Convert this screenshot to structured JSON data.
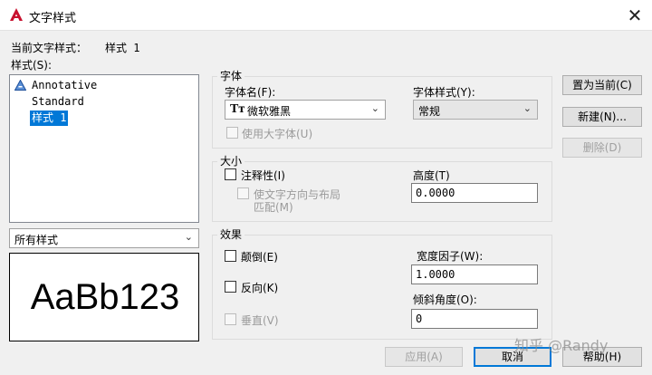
{
  "window": {
    "title": "文字样式",
    "close_glyph": "✕"
  },
  "current_style": {
    "label": "当前文字样式：",
    "value": "样式 1"
  },
  "styles": {
    "label": "样式(S):",
    "items": [
      {
        "label": "Annotative",
        "annotative": true,
        "selected": false
      },
      {
        "label": "Standard",
        "annotative": false,
        "selected": false
      },
      {
        "label": "样式 1",
        "annotative": false,
        "selected": true
      }
    ]
  },
  "filter": {
    "value": "所有样式"
  },
  "preview": {
    "text": "AaBb123"
  },
  "font": {
    "group_label": "字体",
    "name_label": "字体名(F):",
    "name_value": "微软雅黑",
    "style_label": "字体样式(Y):",
    "style_value": "常规",
    "bigfont_label": "使用大字体(U)"
  },
  "size": {
    "group_label": "大小",
    "annotative_label": "注释性(I)",
    "match_orientation_line1": "使文字方向与布局",
    "match_orientation_line2": "匹配(M)",
    "height_label": "高度(T)",
    "height_value": "0.0000"
  },
  "effects": {
    "group_label": "效果",
    "upside_down_label": "颠倒(E)",
    "backwards_label": "反向(K)",
    "vertical_label": "垂直(V)",
    "width_factor_label": "宽度因子(W):",
    "width_factor_value": "1.0000",
    "oblique_label": "倾斜角度(O):",
    "oblique_value": "0"
  },
  "buttons": {
    "set_current": "置为当前(C)",
    "new": "新建(N)...",
    "delete": "删除(D)",
    "apply": "应用(A)",
    "cancel": "取消",
    "help": "帮助(H)"
  },
  "watermark": "知乎 @Randy",
  "colors": {
    "accent": "#0078d7",
    "autocad_red": "#c8102e"
  }
}
